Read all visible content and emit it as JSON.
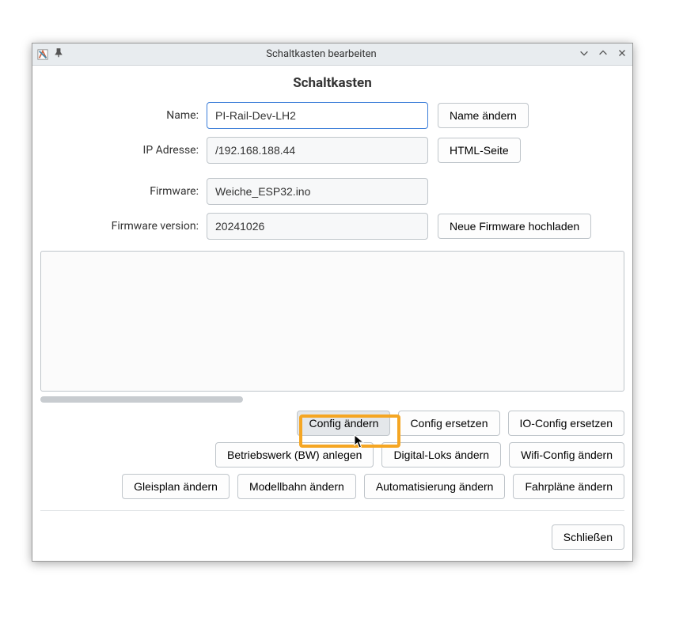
{
  "window": {
    "title": "Schaltkasten bearbeiten"
  },
  "page": {
    "heading": "Schaltkasten"
  },
  "form": {
    "name_label": "Name:",
    "name_value": "PI-Rail-Dev-LH2",
    "name_button": "Name ändern",
    "ip_label": "IP Adresse:",
    "ip_value": "/192.168.188.44",
    "ip_button": "HTML-Seite",
    "fw_label": "Firmware:",
    "fw_value": "Weiche_ESP32.ino",
    "fwver_label": "Firmware version:",
    "fwver_value": "20241026",
    "fwver_button": "Neue Firmware hochladen"
  },
  "buttons": {
    "config_edit": "Config ändern",
    "config_replace": "Config ersetzen",
    "io_config_replace": "IO-Config ersetzen",
    "bw_create": "Betriebswerk (BW) anlegen",
    "digital_loks": "Digital-Loks ändern",
    "wifi_config": "Wifi-Config ändern",
    "trackplan": "Gleisplan ändern",
    "modelrail": "Modellbahn ändern",
    "automation": "Automatisierung ändern",
    "schedules": "Fahrpläne ändern"
  },
  "footer": {
    "close": "Schließen"
  }
}
